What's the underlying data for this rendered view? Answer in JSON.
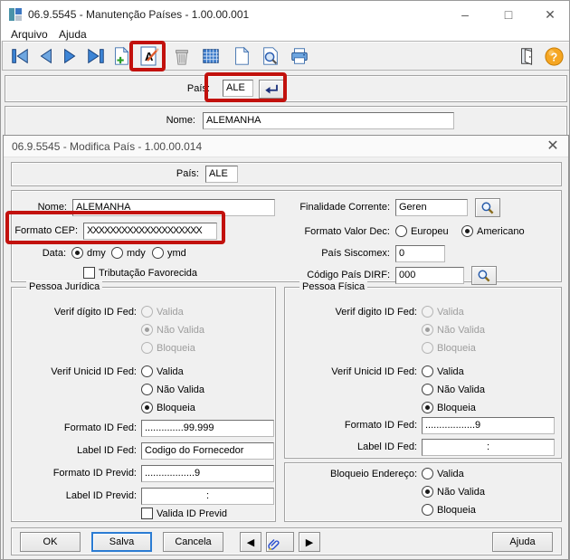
{
  "main_window": {
    "title": "06.9.5545 - Manutenção Países - 1.00.00.001",
    "menu": {
      "arquivo": "Arquivo",
      "ajuda": "Ajuda"
    },
    "toolbar_icons": [
      "first-record",
      "previous-record",
      "next-record",
      "last-record",
      "new-record",
      "edit-record",
      "delete-record",
      "table-view",
      "new-document",
      "query",
      "print",
      "exit",
      "help"
    ],
    "pais": {
      "label": "País:",
      "value": "ALE"
    },
    "nome": {
      "label": "Nome:",
      "value": "ALEMANHA"
    }
  },
  "dialog": {
    "title": "06.9.5545 - Modifica País - 1.00.00.014",
    "pais": {
      "label": "País:",
      "value": "ALE"
    },
    "form": {
      "nome": {
        "label": "Nome:",
        "value": "ALEMANHA"
      },
      "finalidade_corrente": {
        "label": "Finalidade Corrente:",
        "value": "Geren"
      },
      "formato_cep": {
        "label": "Formato CEP:",
        "value": "XXXXXXXXXXXXXXXXXXXX"
      },
      "formato_valor_dec": {
        "label": "Formato Valor Dec:",
        "options": [
          "Europeu",
          "Americano"
        ],
        "selected": "Americano"
      },
      "data": {
        "label": "Data:",
        "options": [
          "dmy",
          "mdy",
          "ymd"
        ],
        "selected": "dmy"
      },
      "pais_siscomex": {
        "label": "País Siscomex:",
        "value": "0"
      },
      "tributacao_favorecida": {
        "label": "Tributação Favorecida",
        "checked": false
      },
      "codigo_pais_dirf": {
        "label": "Código País DIRF:",
        "value": "000"
      }
    },
    "pessoa_juridica": {
      "title": "Pessoa Jurídica",
      "verif_digito": {
        "label": "Verif dígito ID Fed:",
        "options": [
          "Valida",
          "Não Valida",
          "Bloqueia"
        ],
        "selected": "Não Valida",
        "enabled": false
      },
      "verif_unicid": {
        "label": "Verif Unicid ID Fed:",
        "options": [
          "Valida",
          "Não Valida",
          "Bloqueia"
        ],
        "selected": "Bloqueia",
        "enabled": true
      },
      "formato_id_fed": {
        "label": "Formato ID Fed:",
        "value": "..............99.999"
      },
      "label_id_fed": {
        "label": "Label ID Fed:",
        "value": "Codigo do Fornecedor"
      },
      "formato_id_previd": {
        "label": "Formato ID Previd:",
        "value": "..................9"
      },
      "label_id_previd": {
        "label": "Label ID Previd:",
        "value": ":"
      },
      "valida_id_previd": {
        "label": "Valida ID Previd",
        "checked": false
      }
    },
    "pessoa_fisica": {
      "title": "Pessoa Física",
      "verif_digito": {
        "label": "Verif digito ID Fed:",
        "options": [
          "Valida",
          "Não Valida",
          "Bloqueia"
        ],
        "selected": "Não Valida",
        "enabled": false
      },
      "verif_unicid": {
        "label": "Verif Unicid ID Fed:",
        "options": [
          "Valida",
          "Não Valida",
          "Bloqueia"
        ],
        "selected": "Bloqueia",
        "enabled": true
      },
      "formato_id_fed": {
        "label": "Formato ID Fed:",
        "value": "..................9"
      },
      "label_id_fed": {
        "label": "Label ID Fed:",
        "value": ":"
      }
    },
    "bloqueio_endereco": {
      "label": "Bloqueio Endereço:",
      "options": [
        "Valida",
        "Não Valida",
        "Bloqueia"
      ],
      "selected": "Não Valida"
    },
    "buttons": {
      "ok": "OK",
      "salva": "Salva",
      "cancela": "Cancela",
      "ajuda": "Ajuda"
    }
  },
  "annotations": {
    "highlight_color": "#c2110d"
  },
  "colors": {
    "focus_blue": "#2b7cd3",
    "icon_blue": "#3d85d6",
    "help_orange": "#f5a623"
  }
}
